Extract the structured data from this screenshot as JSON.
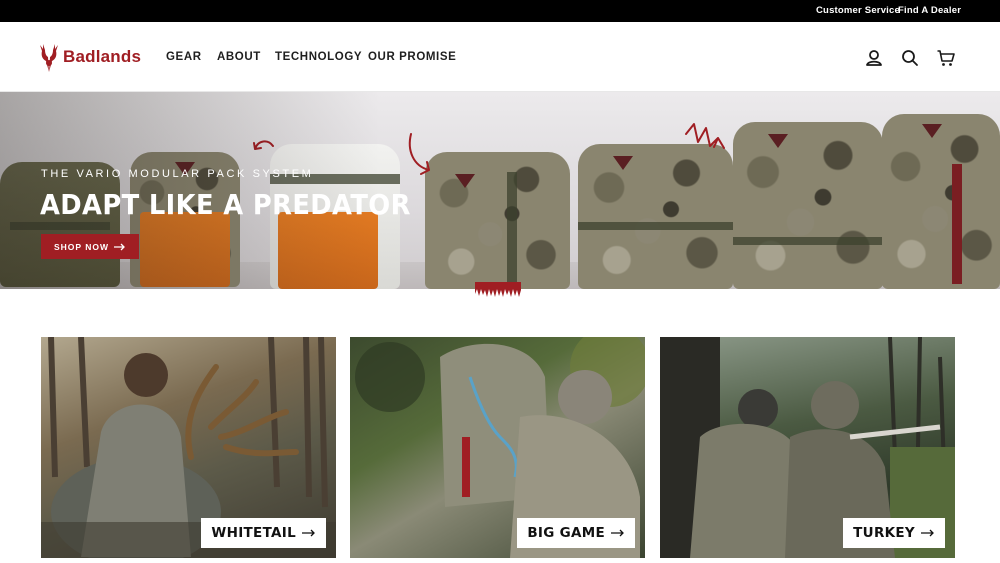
{
  "utility_bar": {
    "customer_service": "Customer Service",
    "find_dealer": "Find A Dealer"
  },
  "header": {
    "brand": "Badlands",
    "nav": [
      {
        "label": "GEAR"
      },
      {
        "label": "ABOUT"
      },
      {
        "label": "TECHNOLOGY"
      },
      {
        "label": "OUR PROMISE"
      }
    ],
    "icons": [
      "account-icon",
      "search-icon",
      "cart-icon"
    ]
  },
  "hero": {
    "eyebrow": "THE VARIO MODULAR PACK SYSTEM",
    "title": "ADAPT LIKE A PREDATOR",
    "cta": "SHOP NOW",
    "cta_icon": "arrow-right-icon"
  },
  "categories": [
    {
      "label": "WHITETAIL",
      "icon": "arrow-right-icon"
    },
    {
      "label": "BIG GAME",
      "icon": "arrow-right-icon"
    },
    {
      "label": "TURKEY",
      "icon": "arrow-right-icon"
    }
  ],
  "colors": {
    "brand_red": "#a01e23",
    "utility_bar": "#000000",
    "nav_text": "#1f1f1f"
  }
}
